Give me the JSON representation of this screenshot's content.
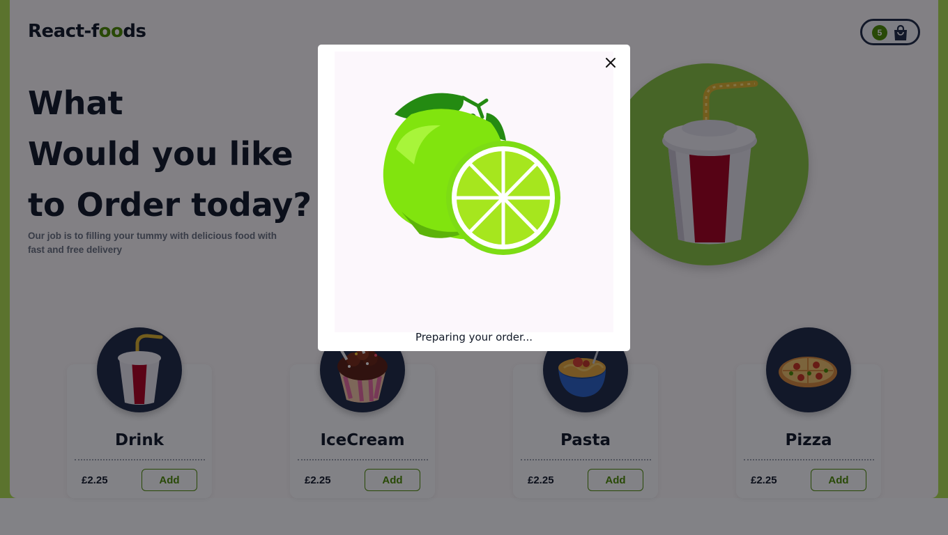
{
  "app": {
    "logo_prefix": "React-f",
    "logo_accent": "oo",
    "logo_suffix": "ds",
    "brand_color": "#4d8c00",
    "background_accent": "#b1e04f"
  },
  "cart": {
    "count": "5",
    "icon": "shopping-bag-icon"
  },
  "hero": {
    "title_line1": "What",
    "title_line2": "Would you like",
    "title_line3": "to Order today?",
    "subtitle": "Our job is to filling your tummy with delicious food with fast and free delivery"
  },
  "products": [
    {
      "name": "Drink",
      "price": "£2.25",
      "add_label": "Add"
    },
    {
      "name": "IceCream",
      "price": "£2.25",
      "add_label": "Add"
    },
    {
      "name": "Pasta",
      "price": "£2.25",
      "add_label": "Add"
    },
    {
      "name": "Pizza",
      "price": "£2.25",
      "add_label": "Add"
    }
  ],
  "modal": {
    "status": "Preparing your order...",
    "close_icon": "close-icon",
    "image": "lime-illustration"
  }
}
